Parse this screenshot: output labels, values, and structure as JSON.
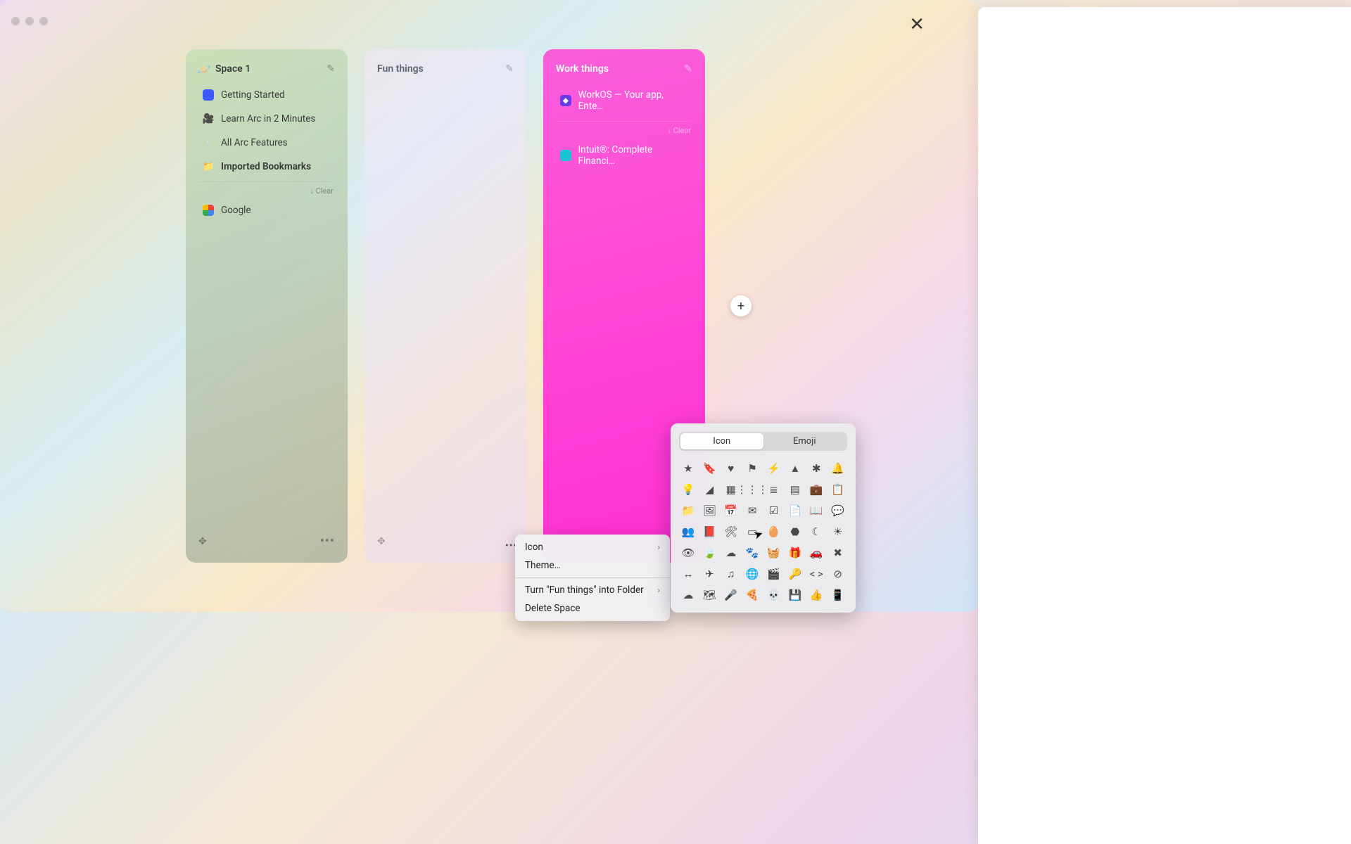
{
  "window": {
    "close_glyph": "✕"
  },
  "spaces": [
    {
      "icon": "🪐",
      "title": "Space 1",
      "items": [
        {
          "icon_class": "favicon-blue",
          "label": "Getting Started",
          "bold": false,
          "emoji": ""
        },
        {
          "icon_class": "",
          "label": "Learn Arc in 2 Minutes",
          "bold": false,
          "emoji": "🎥"
        },
        {
          "icon_class": "",
          "label": "All Arc Features",
          "bold": false,
          "emoji": "▫️"
        },
        {
          "icon_class": "favicon-folder",
          "label": "Imported Bookmarks",
          "bold": true,
          "emoji": "📁"
        }
      ],
      "clear_label": "↓ Clear",
      "below_items": [
        {
          "icon_class": "favicon-google",
          "label": "Google",
          "emoji": ""
        }
      ]
    },
    {
      "title": "Fun things",
      "items": []
    },
    {
      "title": "Work things",
      "pinned": [
        {
          "icon_class": "favicon-workos",
          "icon_text": "◆",
          "label": "WorkOS — Your app, Ente…"
        }
      ],
      "clear_label": "↓ Clear",
      "items": [
        {
          "icon_class": "favicon-intuit",
          "label": "Intuit®: Complete Financi…"
        }
      ]
    }
  ],
  "footer": {
    "move_glyph": "✥",
    "more_glyph": "•••"
  },
  "add_button": {
    "glyph": "+"
  },
  "context_menu": {
    "items": [
      {
        "label": "Icon",
        "has_submenu": true
      },
      {
        "label": "Theme…",
        "has_submenu": false
      },
      {
        "sep": true
      },
      {
        "label": "Turn \"Fun things\" into Folder",
        "has_submenu": true
      },
      {
        "label": "Delete Space",
        "has_submenu": false
      }
    ],
    "chevron": "›"
  },
  "picker": {
    "tabs": {
      "icon": "Icon",
      "emoji": "Emoji",
      "active": "icon"
    },
    "icons": [
      "★",
      "🔖",
      "♥",
      "⚑",
      "⚡",
      "▲",
      "✱",
      "🔔",
      "💡",
      "◢",
      "▦",
      "⋮⋮⋮",
      "≣",
      "▤",
      "💼",
      "📋",
      "📁",
      "🖼",
      "📅",
      "✉",
      "☑",
      "📄",
      "📖",
      "💬",
      "👥",
      "📕",
      "🛠",
      "▭",
      "🥚",
      "⬣",
      "☾",
      "☀",
      "👁",
      "🍃",
      "☁",
      "🐾",
      "🧺",
      "🎁",
      "🚗",
      "✖",
      "↔",
      "✈",
      "♫",
      "🌐",
      "🎬",
      "🔑",
      "< >",
      "⊘",
      "☁︎",
      "🗺",
      "🎤",
      "🍕",
      "💀",
      "💾",
      "👍",
      "📱"
    ]
  },
  "ellipsis_before": "•••"
}
